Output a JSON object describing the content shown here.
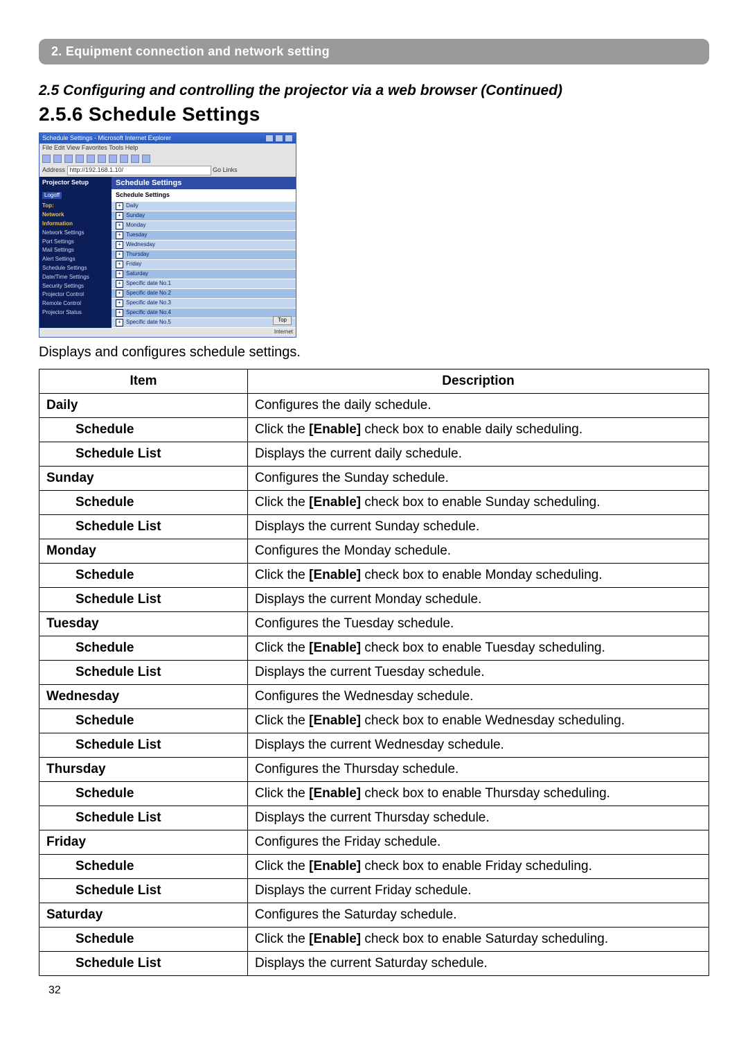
{
  "section_bar": "2. Equipment connection and network setting",
  "section_title": "2.5 Configuring and controlling the projector via a web browser (Continued)",
  "subsection_title": "2.5.6 Schedule Settings",
  "intro_text": "Displays and configures schedule settings.",
  "page_number": "32",
  "mini_browser": {
    "window_title": "Schedule Settings - Microsoft Internet Explorer",
    "menu": "File  Edit  View  Favorites  Tools  Help",
    "address_label": "Address",
    "address_value": "http://192.168.1.10/",
    "go": "Go",
    "links": "Links",
    "sidebar_brand": "Projector Setup",
    "logoff": "Logoff",
    "sidebar_top_bold": "Top:",
    "sidebar_net_bold": "Network",
    "sidebar_info_bold": "Information",
    "sidebar_items": [
      "Network Settings",
      "Port Settings",
      "Mail Settings",
      "Alert Settings",
      "Schedule Settings",
      "Date/Time Settings",
      "Security Settings",
      "Projector Control",
      "Remote Control",
      "Projector Status"
    ],
    "main_header": "Schedule Settings",
    "main_subheader": "Schedule Settings",
    "rows": [
      "Daily",
      "Sunday",
      "Monday",
      "Tuesday",
      "Wednesday",
      "Thursday",
      "Friday",
      "Saturday",
      "Specific date No.1",
      "Specific date No.2",
      "Specific date No.3",
      "Specific date No.4",
      "Specific date No.5"
    ],
    "top_button": "Top",
    "status": "Internet"
  },
  "table": {
    "header_item": "Item",
    "header_desc": "Description",
    "groups": [
      {
        "name": "Daily",
        "desc": "Configures the daily schedule.",
        "sub": [
          {
            "name": "Schedule",
            "desc_pre": "Click the ",
            "desc_bold": "[Enable]",
            "desc_post": " check box to enable daily scheduling."
          },
          {
            "name": "Schedule List",
            "desc": "Displays the current daily schedule."
          }
        ]
      },
      {
        "name": "Sunday",
        "desc": "Configures the Sunday schedule.",
        "sub": [
          {
            "name": "Schedule",
            "desc_pre": "Click the ",
            "desc_bold": "[Enable]",
            "desc_post": " check box to enable Sunday scheduling."
          },
          {
            "name": "Schedule List",
            "desc": "Displays the current Sunday schedule."
          }
        ]
      },
      {
        "name": "Monday",
        "desc": "Configures the Monday schedule.",
        "sub": [
          {
            "name": "Schedule",
            "desc_pre": "Click the ",
            "desc_bold": "[Enable]",
            "desc_post": " check box to enable Monday scheduling."
          },
          {
            "name": "Schedule List",
            "desc": "Displays the current Monday schedule."
          }
        ]
      },
      {
        "name": "Tuesday",
        "desc": "Configures the Tuesday schedule.",
        "sub": [
          {
            "name": "Schedule",
            "desc_pre": "Click the ",
            "desc_bold": "[Enable]",
            "desc_post": " check box to enable Tuesday scheduling."
          },
          {
            "name": "Schedule List",
            "desc": "Displays the current Tuesday schedule."
          }
        ]
      },
      {
        "name": "Wednesday",
        "desc": "Configures the Wednesday schedule.",
        "sub": [
          {
            "name": "Schedule",
            "desc_pre": "Click the ",
            "desc_bold": "[Enable]",
            "desc_post": " check box to enable Wednesday scheduling."
          },
          {
            "name": "Schedule List",
            "desc": "Displays the current Wednesday schedule."
          }
        ]
      },
      {
        "name": "Thursday",
        "desc": "Configures the Thursday schedule.",
        "sub": [
          {
            "name": "Schedule",
            "desc_pre": "Click the ",
            "desc_bold": "[Enable]",
            "desc_post": " check box to enable Thursday scheduling."
          },
          {
            "name": "Schedule List",
            "desc": "Displays the current Thursday schedule."
          }
        ]
      },
      {
        "name": "Friday",
        "desc": "Configures the Friday schedule.",
        "sub": [
          {
            "name": "Schedule",
            "desc_pre": "Click the ",
            "desc_bold": "[Enable]",
            "desc_post": " check box to enable Friday scheduling."
          },
          {
            "name": "Schedule List",
            "desc": "Displays the current Friday schedule."
          }
        ]
      },
      {
        "name": "Saturday",
        "desc": "Configures the Saturday schedule.",
        "sub": [
          {
            "name": "Schedule",
            "desc_pre": "Click the ",
            "desc_bold": "[Enable]",
            "desc_post": " check box to enable Saturday scheduling."
          },
          {
            "name": "Schedule List",
            "desc": "Displays the current Saturday schedule."
          }
        ]
      }
    ]
  }
}
